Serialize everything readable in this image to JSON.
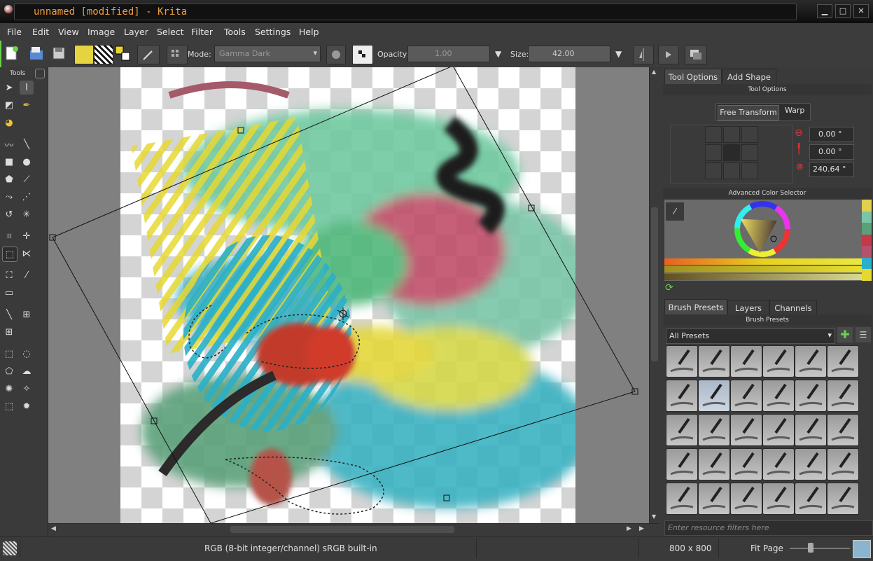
{
  "window": {
    "title": "unnamed [modified] - Krita"
  },
  "menu": [
    "File",
    "Edit",
    "View",
    "Image",
    "Layer",
    "Select",
    "Filter",
    "Tools",
    "Settings",
    "Help"
  ],
  "toolbar": {
    "mode_label": "Mode:",
    "mode_value": "Gamma Dark",
    "opacity_label": "Opacity:",
    "opacity_value": "1.00",
    "size_label": "Size:",
    "size_value": "42.00"
  },
  "toolbox": {
    "title": "Tools"
  },
  "tool_options": {
    "tabs": [
      "Tool Options",
      "Add Shape"
    ],
    "header": "Tool Options",
    "transform_modes": [
      "Free Transform",
      "Warp"
    ],
    "angles": [
      "0.00 °",
      "0.00 °",
      "240.64 °"
    ]
  },
  "color_selector": {
    "header": "Advanced Color Selector"
  },
  "bottom_tabs": [
    "Brush Presets",
    "Layers",
    "Channels"
  ],
  "brush_presets": {
    "header": "Brush Presets",
    "filter_value": "All Presets",
    "search_placeholder": "Enter resource filters here"
  },
  "statusbar": {
    "color_info": "RGB (8-bit integer/channel)  sRGB built-in",
    "dimensions": "800 x 800",
    "zoom": "Fit Page"
  },
  "colors": {
    "accent": "#f29b3c",
    "highlight_green": "#6ad14a"
  }
}
